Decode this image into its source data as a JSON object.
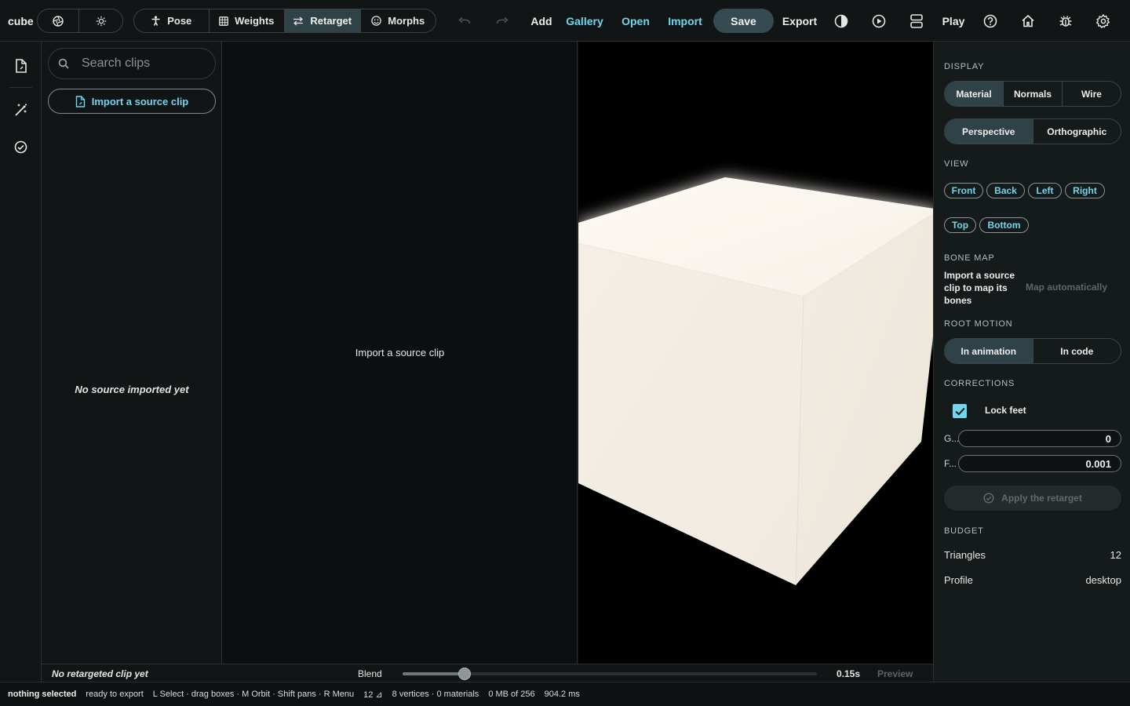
{
  "project": {
    "name": "cube"
  },
  "toolbar": {
    "modes": [
      {
        "label": "Pose",
        "icon": "figure-icon",
        "active": false
      },
      {
        "label": "Weights",
        "icon": "grid-icon",
        "active": false
      },
      {
        "label": "Retarget",
        "icon": "swap-arrows-icon",
        "active": true
      },
      {
        "label": "Morphs",
        "icon": "face-icon",
        "active": false
      }
    ],
    "add": "Add",
    "gallery": "Gallery",
    "open": "Open",
    "import": "Import",
    "save": "Save",
    "export": "Export",
    "play": "Play"
  },
  "clips_panel": {
    "search_placeholder": "Search clips",
    "import_button": "Import a source clip",
    "empty_text": "No source imported yet"
  },
  "graph_panel": {
    "message": "Import a source clip"
  },
  "inspector": {
    "display_label": "DISPLAY",
    "display_modes": [
      {
        "label": "Material",
        "active": true
      },
      {
        "label": "Normals",
        "active": false
      },
      {
        "label": "Wire",
        "active": false
      }
    ],
    "projection_modes": [
      {
        "label": "Perspective",
        "active": true
      },
      {
        "label": "Orthographic",
        "active": false
      }
    ],
    "view_label": "VIEW",
    "views": [
      "Front",
      "Back",
      "Left",
      "Right",
      "Top",
      "Bottom"
    ],
    "bone_map_label": "BONE MAP",
    "bone_map_message": "Import a source clip to map its bones",
    "map_automatically": "Map automatically",
    "root_motion_label": "ROOT MOTION",
    "root_motion_modes": [
      {
        "label": "In animation",
        "active": true
      },
      {
        "label": "In code",
        "active": false
      }
    ],
    "corrections_label": "CORRECTIONS",
    "lock_feet_label": "Lock feet",
    "lock_feet_checked": true,
    "field_g_label": "G...",
    "field_g_value": "0",
    "field_f_label": "F...",
    "field_f_value": "0.001",
    "apply_button": "Apply the retarget",
    "budget_label": "BUDGET",
    "triangles_label": "Triangles",
    "triangles_value": "12",
    "profile_label": "Profile",
    "profile_value": "desktop"
  },
  "timeline": {
    "status": "No retargeted clip yet",
    "blend_label": "Blend",
    "blend_fraction": 0.15,
    "time": "0.15s",
    "preview": "Preview"
  },
  "statusbar": {
    "selection": "nothing selected",
    "export_state": "ready to export",
    "shortcuts": "L Select · drag boxes · M Orbit · Shift pans · R Menu",
    "triangles": "12 ⊿",
    "mesh_stats": "8 vertices · 0 materials",
    "memory": "0 MB of 256",
    "frame_time": "904.2 ms"
  },
  "colors": {
    "accent": "#6fd6ee",
    "active_segment": "#2f4247",
    "panel": "#111516"
  }
}
